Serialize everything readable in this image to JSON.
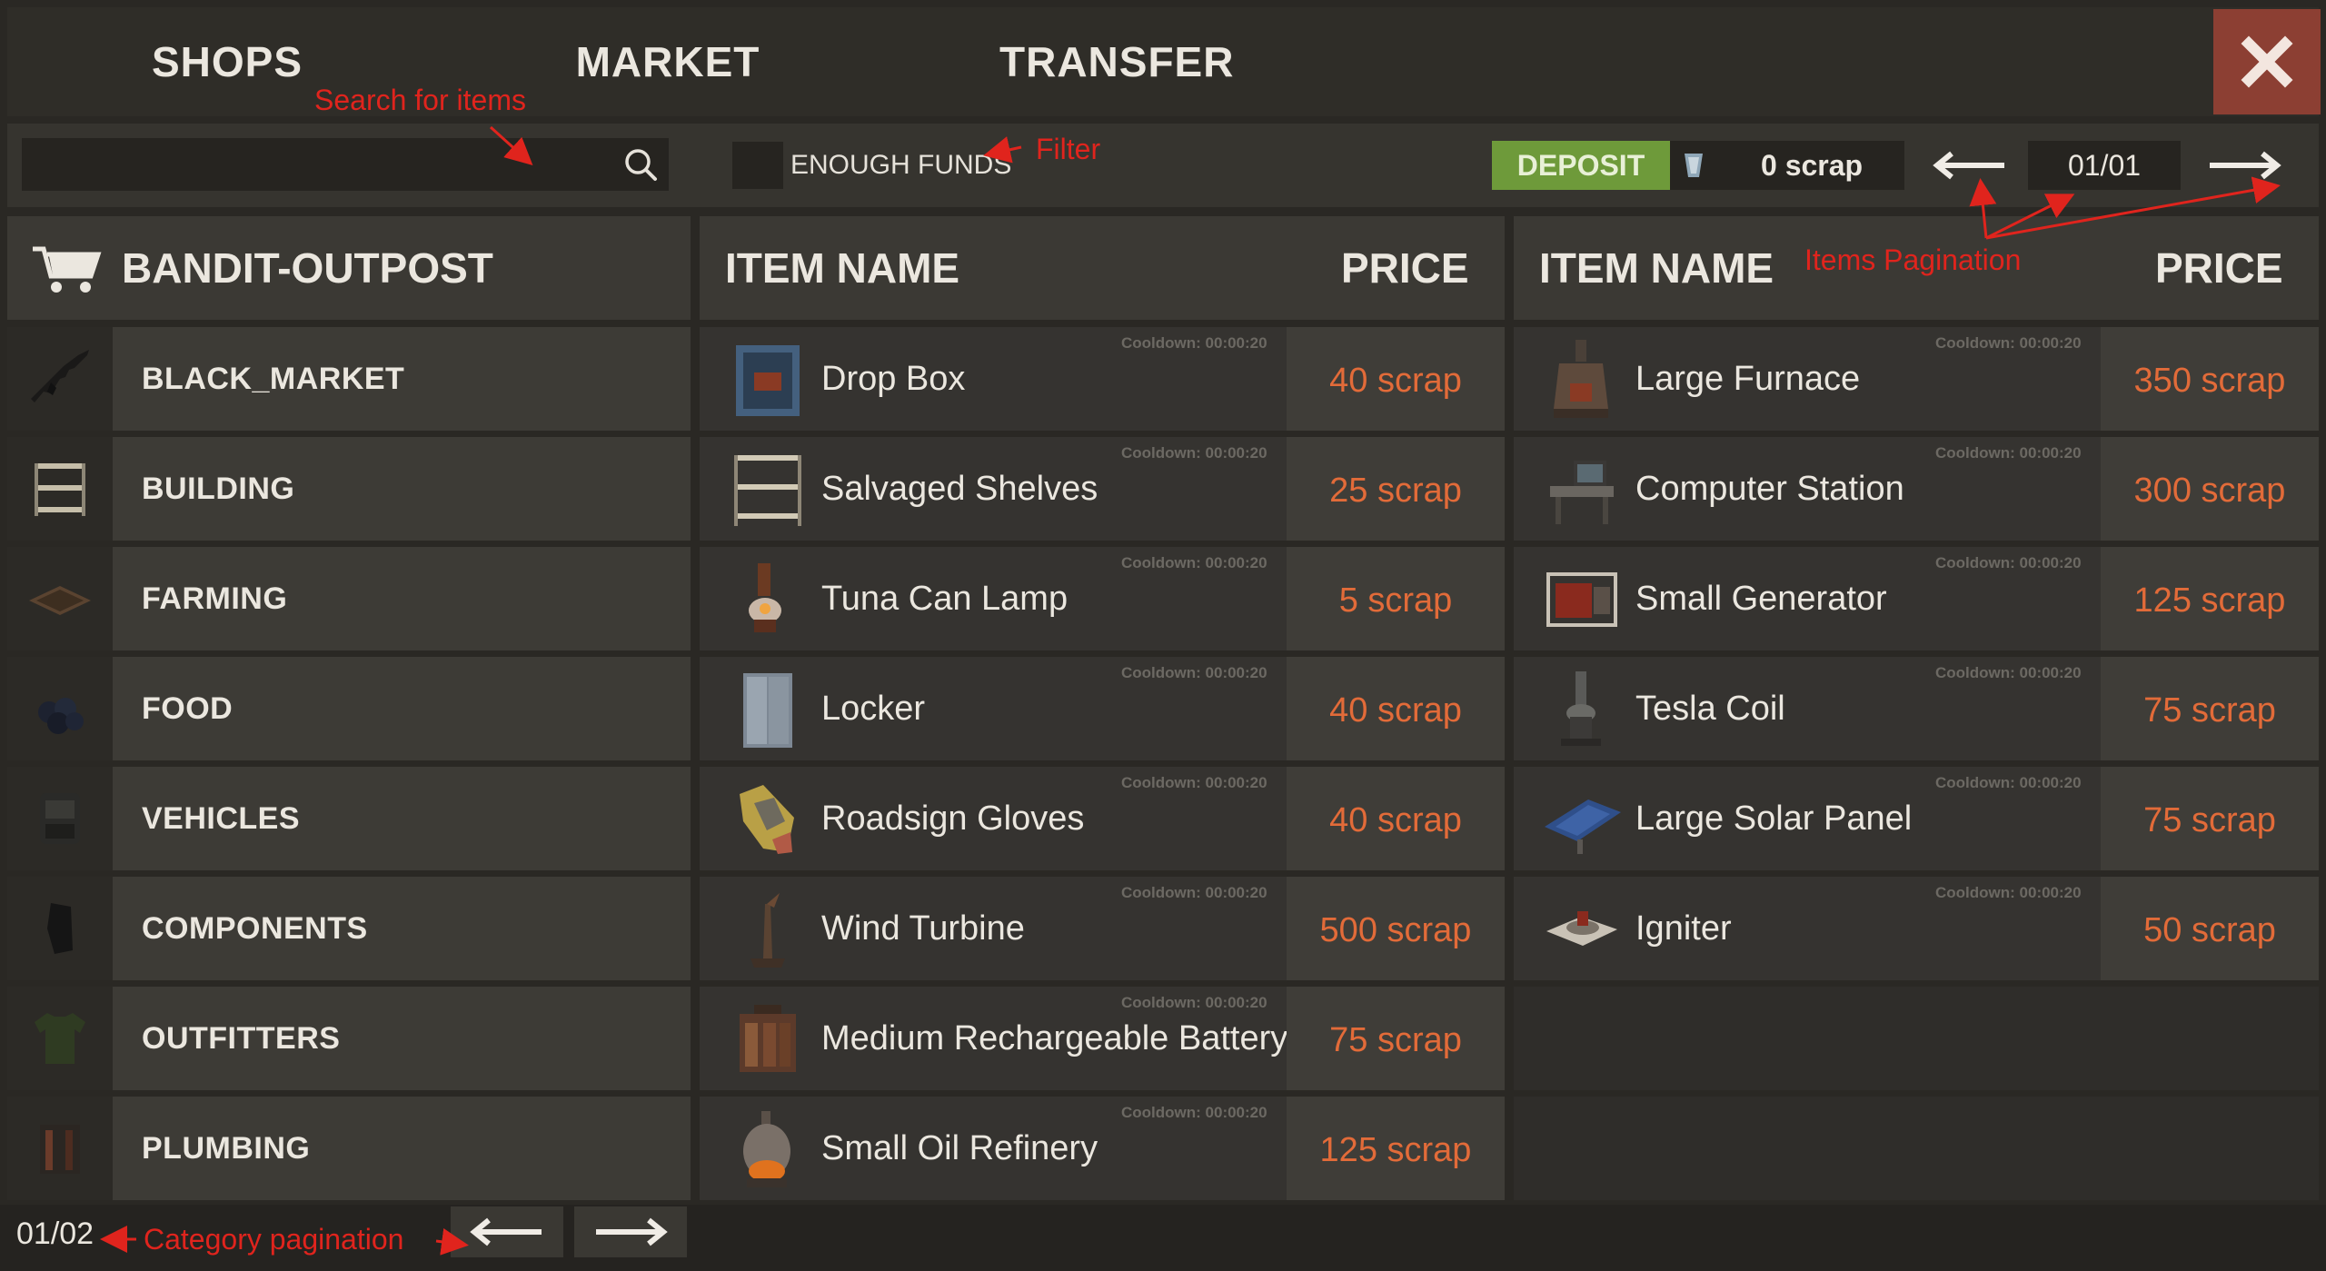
{
  "tabs": [
    "SHOPS",
    "MARKET",
    "TRANSFER"
  ],
  "search": {
    "placeholder": "",
    "value": ""
  },
  "filter": {
    "label": "ENOUGH FUNDS",
    "checked": false
  },
  "deposit": {
    "label": "DEPOSIT",
    "balance": "0 scrap"
  },
  "items_pagination": {
    "display": "01/01"
  },
  "shop": {
    "name": "BANDIT-OUTPOST"
  },
  "categories": [
    {
      "label": "BLACK_MARKET",
      "icon": "rifle-icon"
    },
    {
      "label": "BUILDING",
      "icon": "shelves-icon"
    },
    {
      "label": "FARMING",
      "icon": "planter-icon"
    },
    {
      "label": "FOOD",
      "icon": "berries-icon"
    },
    {
      "label": "VEHICLES",
      "icon": "vehicle-module-icon"
    },
    {
      "label": "COMPONENTS",
      "icon": "component-icon"
    },
    {
      "label": "OUTFITTERS",
      "icon": "shirt-icon"
    },
    {
      "label": "PLUMBING",
      "icon": "pump-icon"
    }
  ],
  "category_pagination": {
    "display": "01/02"
  },
  "headers": {
    "item_name": "ITEM NAME",
    "price": "PRICE"
  },
  "items_left": [
    {
      "name": "Drop Box",
      "price": "40 scrap",
      "cooldown": "Cooldown: 00:00:20",
      "icon": "drop-box-icon"
    },
    {
      "name": "Salvaged Shelves",
      "price": "25 scrap",
      "cooldown": "Cooldown: 00:00:20",
      "icon": "shelves-icon"
    },
    {
      "name": "Tuna Can Lamp",
      "price": "5 scrap",
      "cooldown": "Cooldown: 00:00:20",
      "icon": "lamp-icon"
    },
    {
      "name": "Locker",
      "price": "40 scrap",
      "cooldown": "Cooldown: 00:00:20",
      "icon": "locker-icon"
    },
    {
      "name": "Roadsign Gloves",
      "price": "40 scrap",
      "cooldown": "Cooldown: 00:00:20",
      "icon": "gloves-icon"
    },
    {
      "name": "Wind Turbine",
      "price": "500 scrap",
      "cooldown": "Cooldown: 00:00:20",
      "icon": "wind-turbine-icon"
    },
    {
      "name": "Medium Rechargeable Battery",
      "price": "75 scrap",
      "cooldown": "Cooldown: 00:00:20",
      "icon": "battery-icon"
    },
    {
      "name": "Small Oil Refinery",
      "price": "125 scrap",
      "cooldown": "Cooldown: 00:00:20",
      "icon": "oil-refinery-icon"
    }
  ],
  "items_right": [
    {
      "name": "Large Furnace",
      "price": "350 scrap",
      "cooldown": "Cooldown: 00:00:20",
      "icon": "furnace-icon"
    },
    {
      "name": "Computer Station",
      "price": "300 scrap",
      "cooldown": "Cooldown: 00:00:20",
      "icon": "computer-icon"
    },
    {
      "name": "Small Generator",
      "price": "125 scrap",
      "cooldown": "Cooldown: 00:00:20",
      "icon": "generator-icon"
    },
    {
      "name": "Tesla Coil",
      "price": "75 scrap",
      "cooldown": "Cooldown: 00:00:20",
      "icon": "tesla-coil-icon"
    },
    {
      "name": "Large Solar Panel",
      "price": "75 scrap",
      "cooldown": "Cooldown: 00:00:20",
      "icon": "solar-panel-icon"
    },
    {
      "name": "Igniter",
      "price": "50 scrap",
      "cooldown": "Cooldown: 00:00:20",
      "icon": "igniter-icon"
    }
  ],
  "annotations": {
    "search": "Search for items",
    "filter": "Filter",
    "items_pagination": "Items Pagination",
    "category_pagination": "Category pagination"
  },
  "colors": {
    "background": "#2a2824",
    "panel": "#3b3934",
    "price": "#e26b39",
    "deposit": "#6e9a3a",
    "close": "#8c3f33",
    "annotation": "#e0241d"
  }
}
